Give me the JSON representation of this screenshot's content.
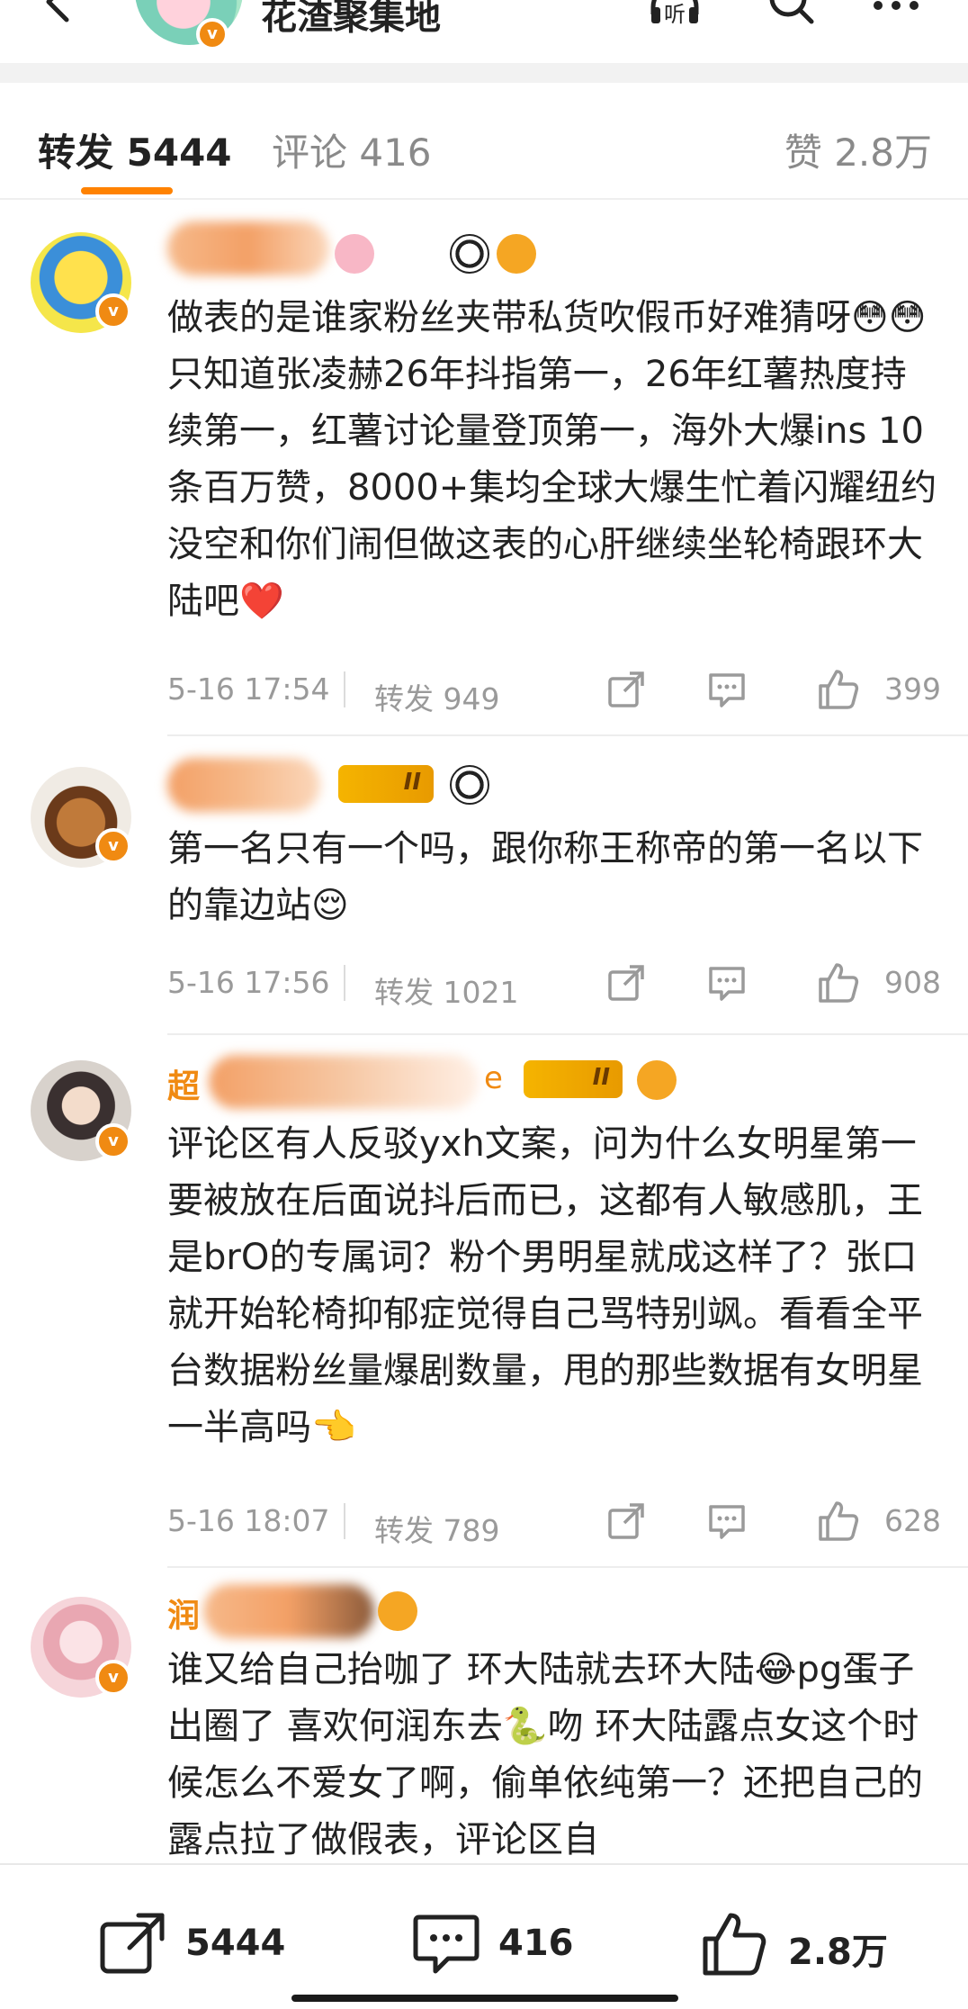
{
  "header": {
    "title": "花渣聚集地",
    "listen_label": "听",
    "verified_mark": "v"
  },
  "tabs": {
    "repost": "转发 5444",
    "comment": "评论 416",
    "like": "赞 2.8万"
  },
  "comments": [
    {
      "name_visible": "",
      "text": "做表的是谁家粉丝夹带私货吹假币好难猜呀😳😳只知道张凌赫26年抖指第一，26年红薯热度持续第一，红薯讨论量登顶第一，海外大爆ins 10条百万赞，8000+集均全球大爆生忙着闪耀纽约没空和你们闹但做这表的心肝继续坐轮椅跟环大陆吧❤️",
      "time": "5-16 17:54",
      "repost": "转发 949",
      "likes": "399"
    },
    {
      "name_visible": "",
      "text": "第一名只有一个吗，跟你称王称帝的第一名以下的靠边站😌",
      "time": "5-16 17:56",
      "repost": "转发 1021",
      "likes": "908"
    },
    {
      "name_visible": "超",
      "name_tail": "e",
      "text": "评论区有人反驳yxh文案，问为什么女明星第一要被放在后面说抖后而已，这都有人敏感肌，王是brO的专属词？粉个男明星就成这样了？张口就开始轮椅抑郁症觉得自己骂特别飒。看看全平台数据粉丝量爆剧数量，甩的那些数据有女明星一半高吗👈",
      "time": "5-16 18:07",
      "repost": "转发 789",
      "likes": "628"
    },
    {
      "name_visible": "润",
      "text": "谁又给自己抬咖了 环大陆就去环大陆😂pg蛋子出圈了 喜欢何润东去🐍吻 环大陆露点女这个时候怎么不爱女了啊，偷单依纯第一？还把自己的露点拉了做假表，评论区自"
    }
  ],
  "badges": {
    "level_roman": "II"
  },
  "bottom_bar": {
    "repost_count": "5444",
    "comment_count": "416",
    "like_count": "2.8万"
  },
  "colors": {
    "accent": "#ff8200",
    "verified": "#f08a12",
    "meta_text": "#9a9a9a"
  }
}
